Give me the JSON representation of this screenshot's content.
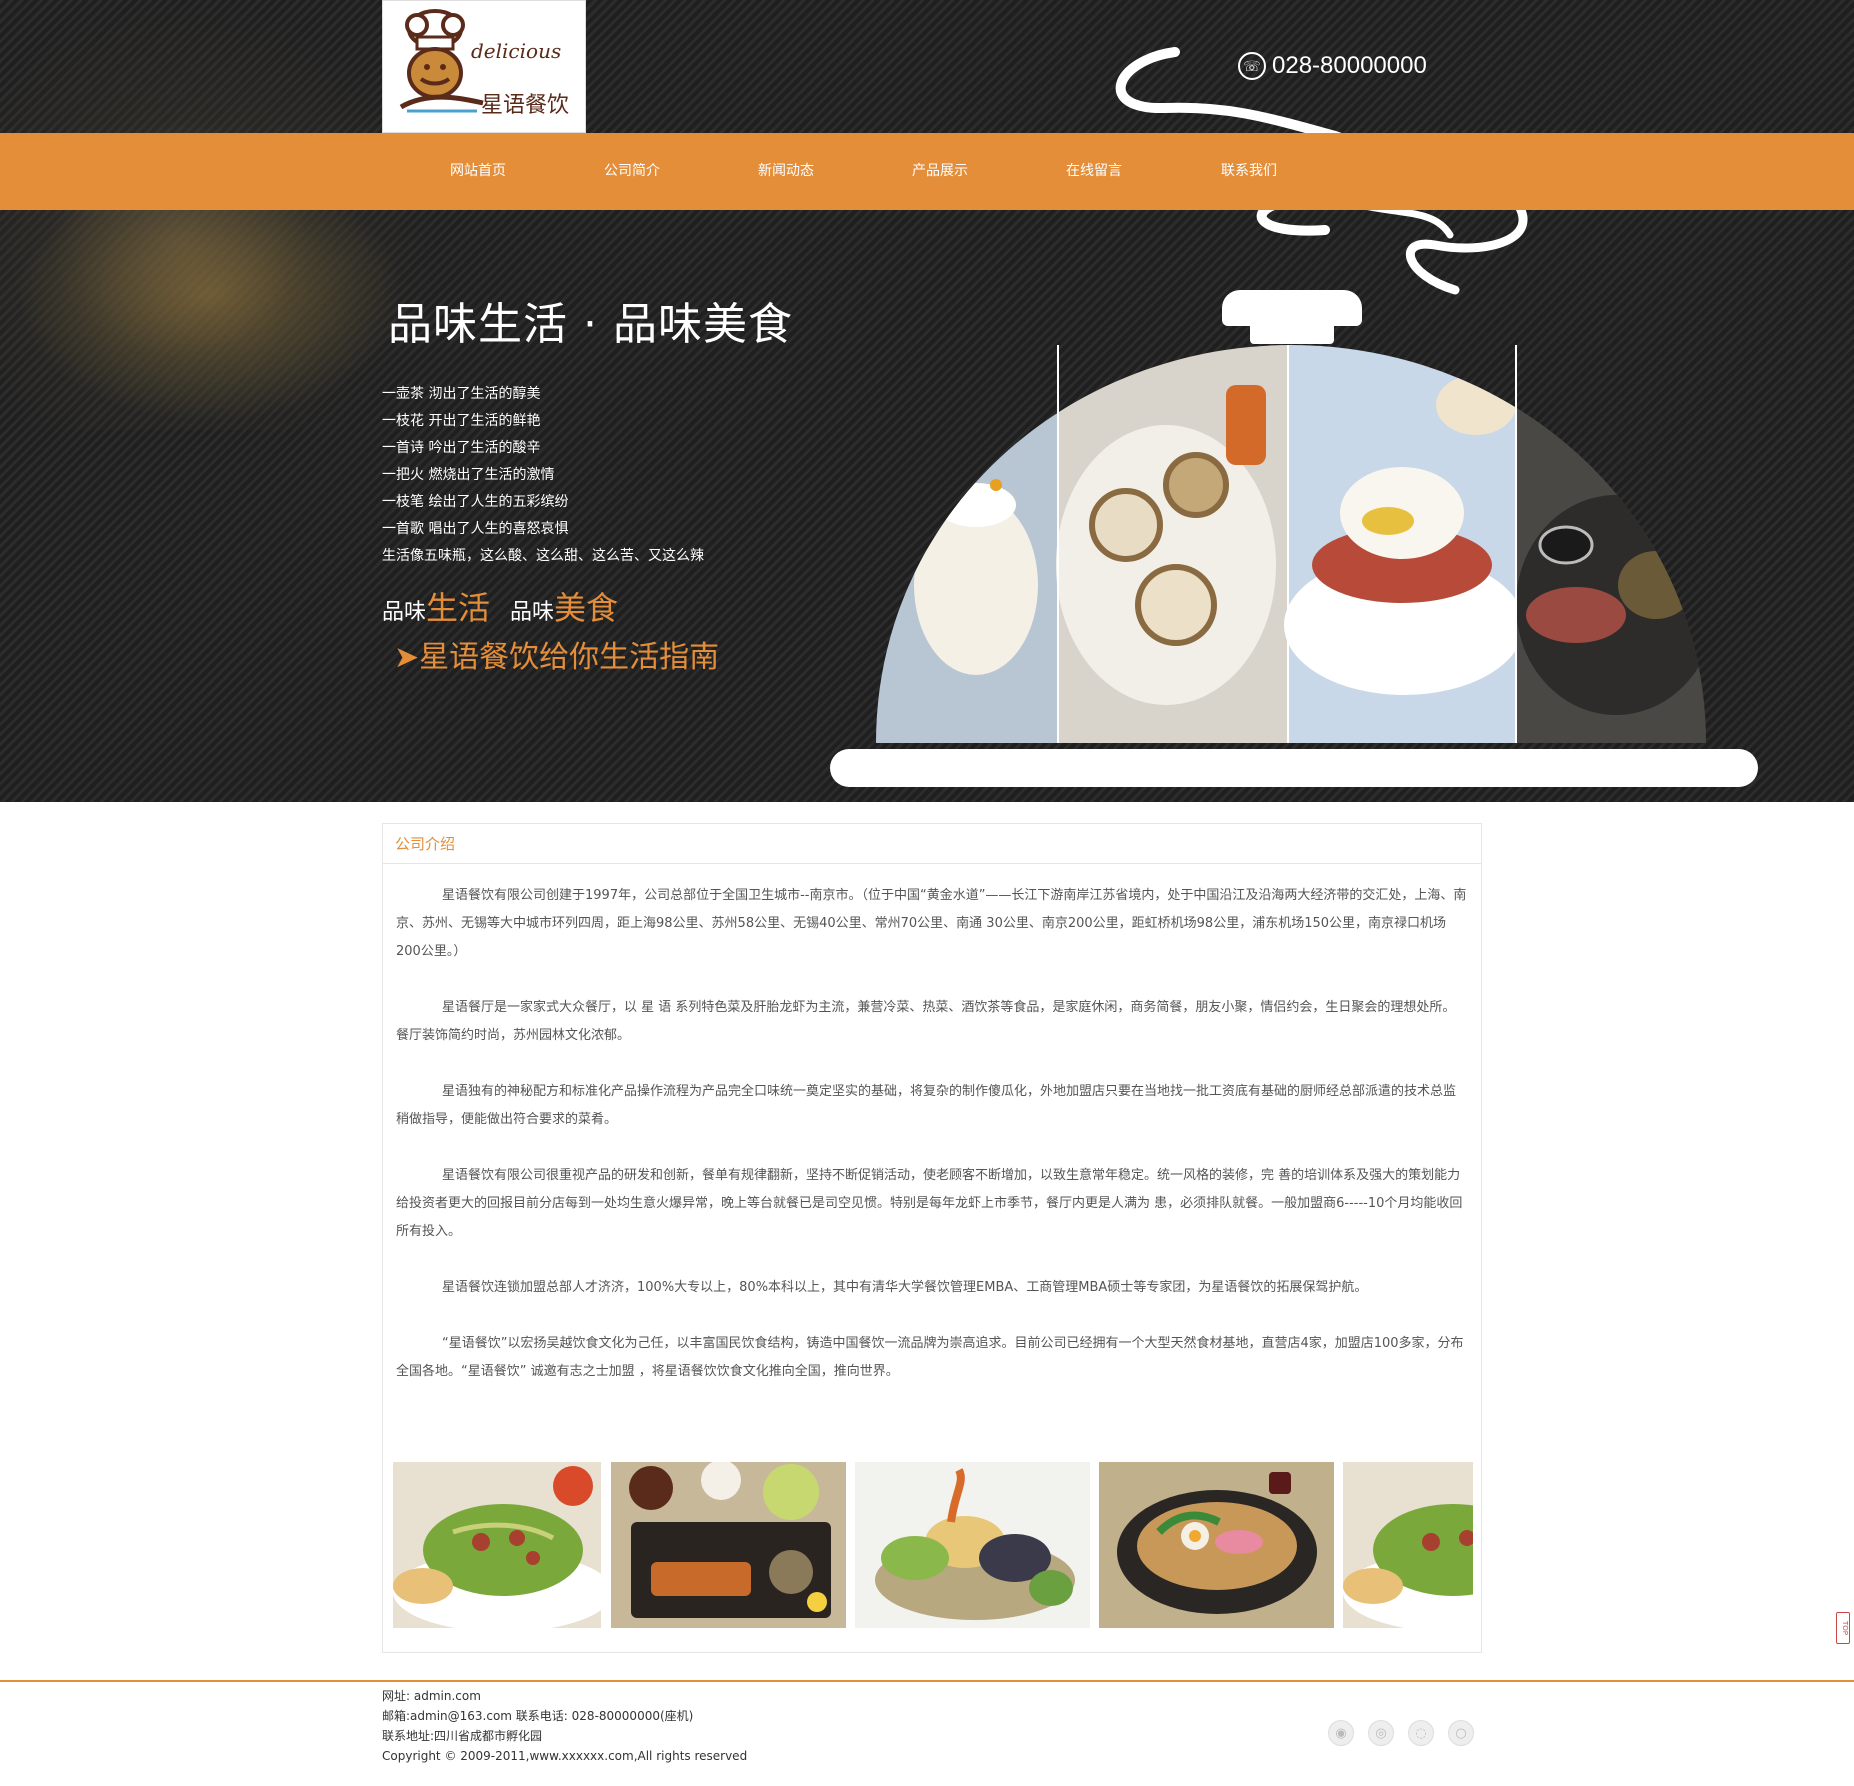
{
  "brand": {
    "logo_en": "delicious",
    "logo_cn": "星语餐饮",
    "phone": "028-80000000"
  },
  "nav": [
    {
      "label": "网站首页"
    },
    {
      "label": "公司简介"
    },
    {
      "label": "新闻动态"
    },
    {
      "label": "产品展示"
    },
    {
      "label": "在线留言"
    },
    {
      "label": "联系我们"
    }
  ],
  "hero": {
    "title": "品味生活 · 品味美食",
    "poem": [
      "一壶茶  沏出了生活的醇美",
      "一枝花  开出了生活的鲜艳",
      "一首诗  吟出了生活的酸辛",
      "一把火  燃烧出了生活的激情",
      "一枝笔  绘出了人生的五彩缤纷",
      "一首歌  唱出了人生的喜怒哀惧",
      "生活像五味瓶，这么酸、这么甜、这么苦、又这么辣"
    ],
    "taste1_w": "品味",
    "taste1_o": "生活",
    "taste2_w": "品味",
    "taste2_o": "美食",
    "guide": "➤星语餐饮给你生活指南"
  },
  "about": {
    "title": "公司介绍",
    "paragraphs": [
      "星语餐饮有限公司创建于1997年，公司总部位于全国卫生城市--南京市。（位于中国“黄金水道”——长江下游南岸江苏省境内，处于中国沿江及沿海两大经济带的交汇处，上海、南京、苏州、无锡等大中城市环列四周，距上海98公里、苏州58公里、无锡40公里、常州70公里、南通 30公里、南京200公里，距虹桥机场98公里，浦东机场150公里，南京禄口机场200公里。）",
      "星语餐厅是一家家式大众餐厅，以 星 语 系列特色菜及肝胎龙虾为主流，兼营冷菜、热菜、酒饮茶等食品，是家庭休闲，商务简餐，朋友小聚，情侣约会，生日聚会的理想处所。餐厅装饰简约时尚，苏州园林文化浓郁。",
      "星语独有的神秘配方和标准化产品操作流程为产品完全口味统一奠定坚实的基础，将复杂的制作傻瓜化，外地加盟店只要在当地找一批工资底有基础的厨师经总部派遣的技术总监稍做指导，便能做出符合要求的菜肴。",
      "星语餐饮有限公司很重视产品的研发和创新，餐单有规律翻新，坚持不断促销活动，使老顾客不断增加，以致生意常年稳定。统一风格的装修，完 善的培训体系及强大的策划能力给投资者更大的回报目前分店每到一处均生意火爆异常，晚上等台就餐已是司空见惯。特别是每年龙虾上市季节，餐厅内更是人满为 患，必须排队就餐。一般加盟商6-----10个月均能收回所有投入。",
      "星语餐饮连锁加盟总部人才济济，100%大专以上，80%本科以上，其中有清华大学餐饮管理EMBA、工商管理MBA硕士等专家团，为星语餐饮的拓展保驾护航。",
      "“星语餐饮”以宏扬吴越饮食文化为己任，以丰富国民饮食结构，铸造中国餐饮一流品牌为崇高追求。目前公司已经拥有一个大型天然食材基地，直营店4家，加盟店100多家，分布全国各地。“星语餐饮” 诚邀有志之士加盟 ，将星语餐饮饮食文化推向全国，推向世界。"
    ]
  },
  "gallery_icons": [
    "salad-photo",
    "tonkatsu-set-photo",
    "tempura-photo",
    "udon-pot-photo",
    "salad-photo"
  ],
  "top_button": "TOP",
  "footer": {
    "website": "网址: admin.com",
    "contact": "邮箱:admin@163.com  联系电话: 028-80000000(座机)",
    "address": "联系地址:四川省成都市孵化园",
    "copyright": "Copyright © 2009-2011,www.xxxxxx.com,All rights reserved"
  },
  "social_icons": [
    "qq-icon",
    "weibo-icon",
    "wechat-icon",
    "share-icon"
  ],
  "colors": {
    "accent": "#e58e3a",
    "dark_bg": "#262626"
  }
}
